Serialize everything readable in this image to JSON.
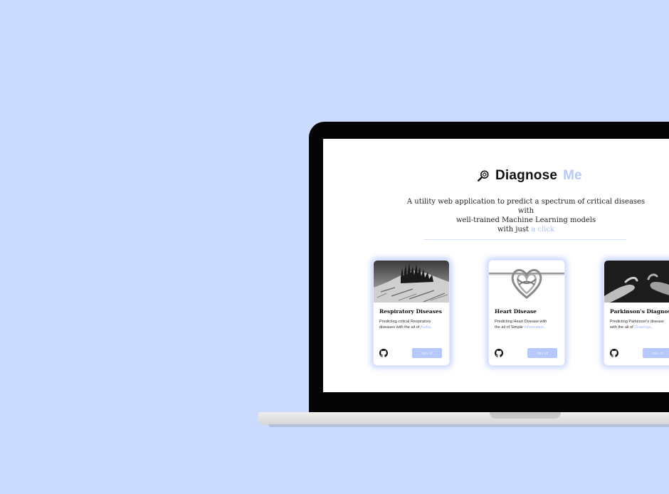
{
  "brand": {
    "name": "Diagnose",
    "accent": "Me",
    "icon": "magnifier-virus-icon"
  },
  "tagline": {
    "line1": "A utility web application to predict a spectrum of critical diseases with",
    "line2": "well-trained Machine Learning models",
    "line3_prefix": "with just ",
    "line3_highlight": "a click"
  },
  "cards": [
    {
      "title": "Respiratory Diseases",
      "desc_line1": "Predicting critical Respiratory",
      "desc_line2_prefix": "diseases with the ail of ",
      "desc_link": "Audio",
      "desc_suffix": ".",
      "button": "TRY IT",
      "icon": "github-icon"
    },
    {
      "title": "Heart Disease",
      "desc_line1": "Predicting Heart Disease with",
      "desc_line2_prefix": "the ail of Simple ",
      "desc_link": "Information",
      "desc_suffix": ".",
      "button": "TRY IT",
      "icon": "github-icon"
    },
    {
      "title": "Parkinson's Diagnosis",
      "desc_line1": "Predicting Parkinson's disease",
      "desc_line2_prefix": "with the ail of ",
      "desc_link": "Drawings",
      "desc_suffix": ".",
      "button": "TRY IT",
      "icon": "github-icon"
    }
  ],
  "colors": {
    "background": "#cbdaff",
    "accent": "#b5c9ff",
    "button": "#b5c8ff"
  }
}
